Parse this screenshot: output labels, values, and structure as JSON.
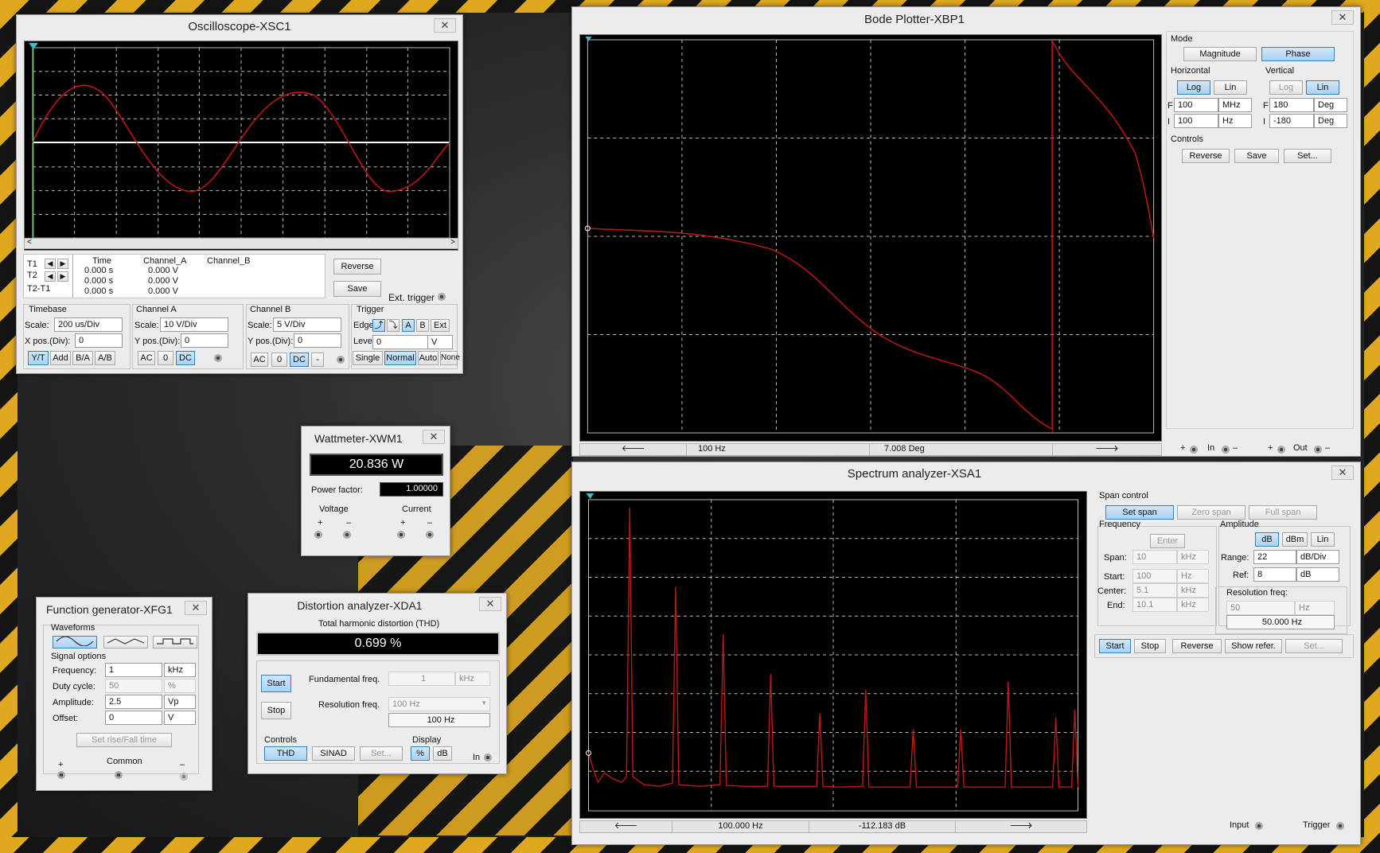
{
  "oscilloscope": {
    "title": "Oscilloscope-XSC1",
    "close": "✕",
    "table": {
      "headers": [
        "Time",
        "Channel_A",
        "Channel_B"
      ],
      "rows": [
        {
          "label": "T1",
          "time": "0.000 s",
          "cha": "0.000 V"
        },
        {
          "label": "T2",
          "time": "0.000 s",
          "cha": "0.000 V"
        },
        {
          "label": "T2-T1",
          "time": "0.000 s",
          "cha": "0.000 V"
        }
      ]
    },
    "reverse": "Reverse",
    "save": "Save",
    "ext_trigger": "Ext. trigger",
    "timebase": {
      "title": "Timebase",
      "scale_label": "Scale:",
      "scale": "200 us/Div",
      "xpos_label": "X pos.(Div):",
      "xpos": "0",
      "buttons": [
        "Y/T",
        "Add",
        "B/A",
        "A/B"
      ]
    },
    "channel_a": {
      "title": "Channel A",
      "scale_label": "Scale:",
      "scale": "10  V/Div",
      "ypos_label": "Y pos.(Div):",
      "ypos": "0",
      "buttons": [
        "AC",
        "0",
        "DC"
      ]
    },
    "channel_b": {
      "title": "Channel B",
      "scale_label": "Scale:",
      "scale": "5  V/Div",
      "ypos_label": "Y pos.(Div):",
      "ypos": "0",
      "buttons": [
        "AC",
        "0",
        "DC",
        "-"
      ]
    },
    "trigger": {
      "title": "Trigger",
      "edge_label": "Edge:",
      "edge_buttons": [
        "A",
        "B",
        "Ext"
      ],
      "level_label": "Level:",
      "level": "0",
      "level_unit": "V",
      "buttons": [
        "Single",
        "Normal",
        "Auto",
        "None"
      ]
    }
  },
  "bode": {
    "title": "Bode Plotter-XBP1",
    "close": "✕",
    "mode": {
      "title": "Mode",
      "magnitude": "Magnitude",
      "phase": "Phase"
    },
    "horizontal": {
      "title": "Horizontal",
      "log": "Log",
      "lin": "Lin",
      "f_label": "F",
      "f_value": "100",
      "f_unit": "MHz",
      "i_label": "I",
      "i_value": "100",
      "i_unit": "Hz"
    },
    "vertical": {
      "title": "Vertical",
      "log": "Log",
      "lin": "Lin",
      "f_label": "F",
      "f_value": "180",
      "f_unit": "Deg",
      "i_label": "I",
      "i_value": "-180",
      "i_unit": "Deg"
    },
    "controls": {
      "title": "Controls",
      "reverse": "Reverse",
      "save": "Save",
      "set": "Set..."
    },
    "readout_freq": "100  Hz",
    "readout_value": "7.008 Deg",
    "terminals": {
      "plus": "+",
      "in": "In",
      "minus": "–",
      "out": "Out"
    }
  },
  "wattmeter": {
    "title": "Wattmeter-XWM1",
    "close": "✕",
    "reading": "20.836 W",
    "pf_label": "Power factor:",
    "pf_value": "1.00000",
    "voltage": "Voltage",
    "current": "Current",
    "plus": "+",
    "minus": "–"
  },
  "function_gen": {
    "title": "Function generator-XFG1",
    "close": "✕",
    "waveforms_title": "Waveforms",
    "signal_title": "Signal options",
    "frequency_label": "Frequency:",
    "frequency": "1",
    "frequency_unit": "kHz",
    "duty_label": "Duty cycle:",
    "duty": "50",
    "duty_unit": "%",
    "amplitude_label": "Amplitude:",
    "amplitude": "2.5",
    "amplitude_unit": "Vp",
    "offset_label": "Offset:",
    "offset": "0",
    "offset_unit": "V",
    "set_rise": "Set rise/Fall time",
    "plus": "+",
    "common": "Common",
    "minus": "–"
  },
  "distortion": {
    "title": "Distortion analyzer-XDA1",
    "close": "✕",
    "thd_title": "Total harmonic distortion (THD)",
    "reading": "0.699 %",
    "start": "Start",
    "stop": "Stop",
    "fund_label": "Fundamental freq.",
    "fund_value": "1",
    "fund_unit": "kHz",
    "res_label": "Resolution freq.",
    "res_select": "100 Hz",
    "res_value": "100 Hz",
    "controls_title": "Controls",
    "thd": "THD",
    "sinad": "SINAD",
    "set": "Set...",
    "display_title": "Display",
    "pct": "%",
    "db": "dB",
    "in": "In"
  },
  "spectrum": {
    "title": "Spectrum analyzer-XSA1",
    "close": "✕",
    "span_title": "Span control",
    "set_span": "Set span",
    "zero_span": "Zero span",
    "full_span": "Full span",
    "freq_title": "Frequency",
    "enter": "Enter",
    "span_label": "Span:",
    "span_value": "10",
    "span_unit": "kHz",
    "start_label": "Start:",
    "start_value": "100",
    "start_unit": "Hz",
    "center_label": "Center:",
    "center_value": "5.1",
    "center_unit": "kHz",
    "end_label": "End:",
    "end_value": "10.1",
    "end_unit": "kHz",
    "amp_title": "Amplitude",
    "db": "dB",
    "dbm": "dBm",
    "lin": "Lin",
    "range_label": "Range:",
    "range_value": "22",
    "range_unit": "dB/Div",
    "ref_label": "Ref:",
    "ref_value": "8",
    "ref_unit": "dB",
    "resfreq_title": "Resolution freq:",
    "resfreq_value": "50",
    "resfreq_unit": "Hz",
    "resfreq_display": "50.000  Hz",
    "start": "Start",
    "stop": "Stop",
    "reverse": "Reverse",
    "show_refer": "Show refer.",
    "set": "Set...",
    "readout_freq": "100.000  Hz",
    "readout_value": "-112.183  dB",
    "input": "Input",
    "trigger": "Trigger"
  },
  "colors": {
    "trace": "#c01818",
    "grid": "#bdbdbd",
    "screen": "#000000",
    "active_button": "#a9d2f5"
  }
}
